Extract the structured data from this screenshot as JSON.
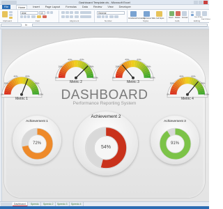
{
  "window": {
    "title": "Dashboard Template.xls - Microsoft Excel"
  },
  "ribbon_tabs": [
    "File",
    "Home",
    "Insert",
    "Page Layout",
    "Formulas",
    "Data",
    "Review",
    "View",
    "Developer"
  ],
  "ribbon": {
    "font_name": "Arial",
    "font_size": "10",
    "number_format": "General",
    "groups": [
      "Clipboard",
      "Font",
      "Alignment",
      "Number",
      "Styles",
      "Cells",
      "Editing"
    ],
    "styles": [
      "Conditional Formatting",
      "Format as Table",
      "Cell Styles"
    ],
    "cells": [
      "Insert",
      "Delete",
      "Format"
    ],
    "editing": [
      "Sort & Filter",
      "Find & Select"
    ]
  },
  "gauges": [
    {
      "label": "Metric 1",
      "value": 0.62,
      "ticks": [
        "0%",
        "20%",
        "40%",
        "60%",
        "80%",
        "100%"
      ]
    },
    {
      "label": "Metric 2",
      "value": 0.75,
      "ticks": [
        "0%",
        "20%",
        "40%",
        "60%",
        "80%",
        "100%"
      ]
    },
    {
      "label": "Metric 3",
      "value": 0.28,
      "ticks": [
        "0%",
        "20%",
        "40%",
        "60%",
        "80%",
        "100%"
      ]
    },
    {
      "label": "Metric 4",
      "value": 0.72,
      "ticks": [
        "0%",
        "20%",
        "40%",
        "60%",
        "80%",
        "100%"
      ]
    }
  ],
  "dashboard": {
    "title": "DASHBOARD",
    "subtitle": "Performance Reporting System"
  },
  "achievements": [
    {
      "label": "Achievement 1",
      "percent": "72%",
      "value": 72,
      "color": "#ee8a2a"
    },
    {
      "label": "Achievement 2",
      "percent": "54%",
      "value": 54,
      "color": "#c9321c"
    },
    {
      "label": "Achievement 3",
      "percent": "91%",
      "value": 91,
      "color": "#7cc348"
    }
  ],
  "sheet_tabs": [
    "Dashboard",
    "Speedo",
    "Speedo 2",
    "Speedo 3",
    "Speedo 4"
  ],
  "colors": {
    "red": "#d8261b",
    "yellow": "#f2d21e",
    "green": "#37a52c"
  }
}
